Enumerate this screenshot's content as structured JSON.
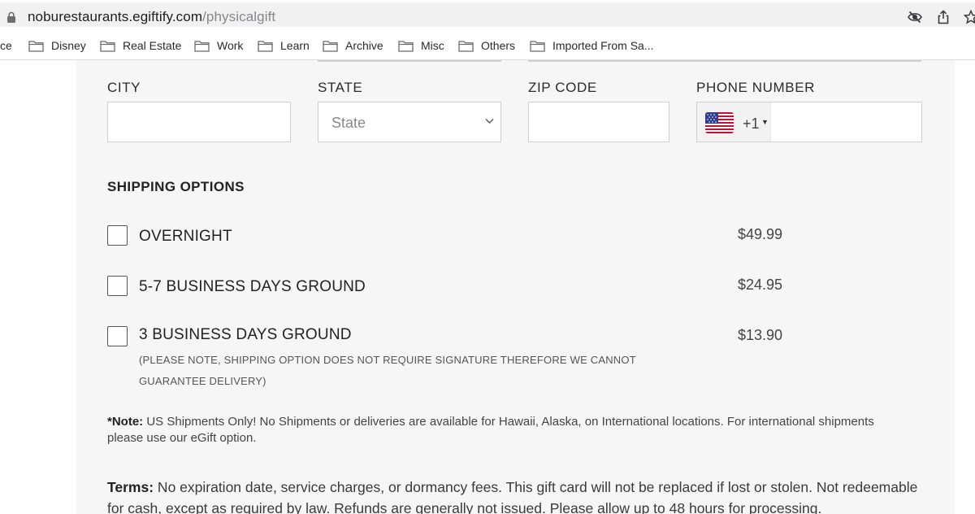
{
  "browser": {
    "url_host": "noburestaurants.egiftify.com",
    "url_path": "/physicalgift",
    "icons": [
      "lock-icon",
      "hide-eye-icon",
      "share-icon",
      "star-icon"
    ]
  },
  "bookmarks": [
    {
      "label": "ce",
      "folder": false
    },
    {
      "label": "Disney",
      "folder": true
    },
    {
      "label": "Real Estate",
      "folder": true
    },
    {
      "label": "Work",
      "folder": true
    },
    {
      "label": "Learn",
      "folder": true
    },
    {
      "label": "Archive",
      "folder": true
    },
    {
      "label": "Misc",
      "folder": true
    },
    {
      "label": "Others",
      "folder": true
    },
    {
      "label": "Imported From Sa...",
      "folder": true
    }
  ],
  "form": {
    "city_label": "CITY",
    "city_value": "",
    "state_label": "STATE",
    "state_selected": "State",
    "zip_label": "ZIP CODE",
    "zip_value": "",
    "phone_label": "PHONE NUMBER",
    "phone_country_flag": "us-flag-icon",
    "phone_dial_code": "+1",
    "phone_value": ""
  },
  "shipping": {
    "title": "SHIPPING OPTIONS",
    "options": [
      {
        "label": "OVERNIGHT",
        "price": "$49.99",
        "checked": false
      },
      {
        "label": "5-7 BUSINESS DAYS GROUND",
        "price": "$24.95",
        "checked": false
      },
      {
        "label": "3 BUSINESS DAYS GROUND",
        "price": "$13.90",
        "checked": false,
        "note": "(PLEASE NOTE, SHIPPING OPTION DOES NOT REQUIRE SIGNATURE THEREFORE WE CANNOT GUARANTEE DELIVERY)"
      }
    ]
  },
  "note": {
    "label": "*Note:",
    "text": " US Shipments Only! No Shipments or deliveries are available for Hawaii, Alaska, on International locations. For international shipments please use our eGift option."
  },
  "terms": {
    "label": "Terms:",
    "text": " No expiration date, service charges, or dormancy fees. This gift card will not be replaced if lost or stolen. Not redeemable for cash, except as required by law. Refunds are generally not issued. Please allow up to 48 hours for processing."
  },
  "colors": {
    "page_background": "#f6f6f6",
    "input_border": "#cfcfcf",
    "text_primary": "#222222",
    "price_text": "#444444"
  }
}
